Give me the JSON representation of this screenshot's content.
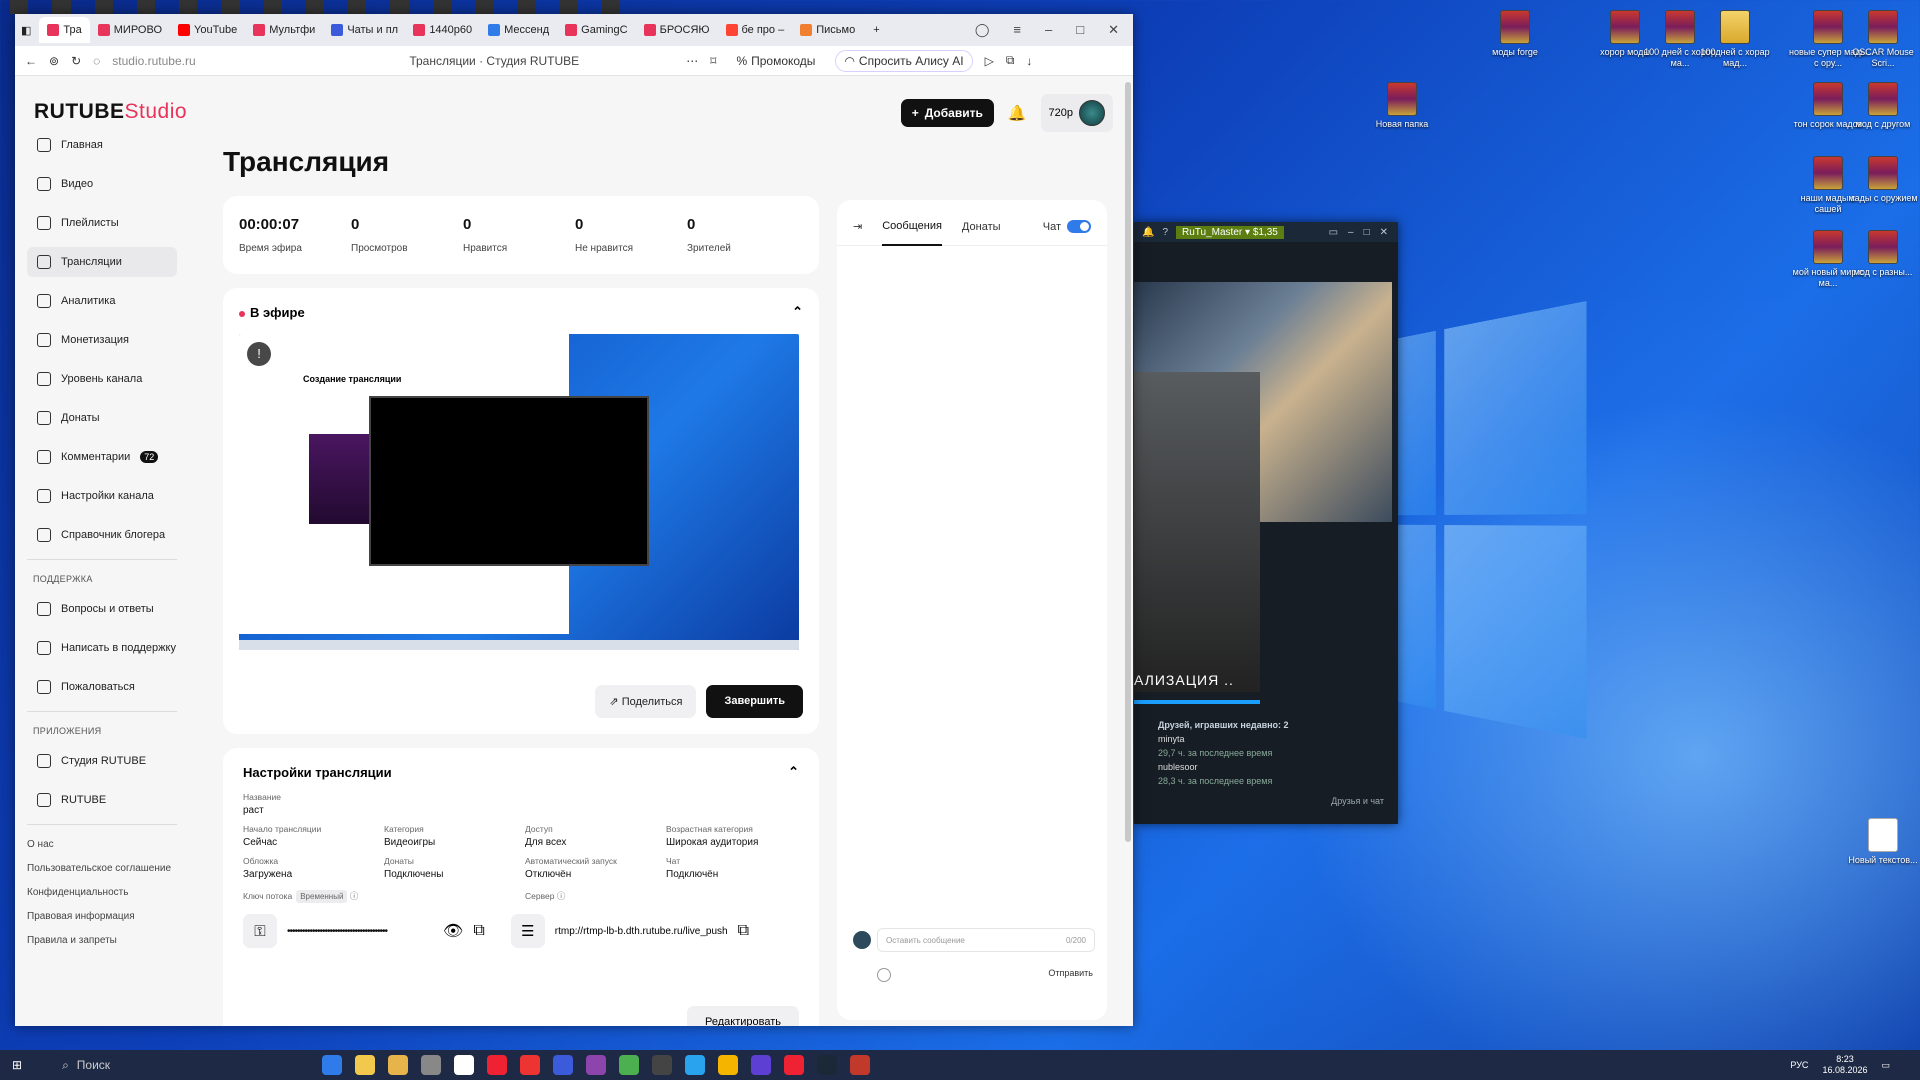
{
  "desktop": {
    "icons": [
      {
        "label": "моды forge",
        "kind": "rar"
      },
      {
        "label": "хорор моды",
        "kind": "rar"
      },
      {
        "label": "100 дней с хорор ма...",
        "kind": "rar"
      },
      {
        "label": "100дней с хорар мад...",
        "kind": "folder"
      },
      {
        "label": "новые супер мады с ору...",
        "kind": "rar"
      },
      {
        "label": "OSCAR Mouse Scri...",
        "kind": "rar"
      },
      {
        "label": "Новая папка",
        "kind": "rar"
      },
      {
        "label": "тон сорок мадов",
        "kind": "rar"
      },
      {
        "label": "мод с другом",
        "kind": "rar"
      },
      {
        "label": "наши мады с сашей",
        "kind": "rar"
      },
      {
        "label": "мады с оружием",
        "kind": "rar"
      },
      {
        "label": "мой новый мир с ма...",
        "kind": "rar"
      },
      {
        "label": "мод с разны...",
        "kind": "rar"
      },
      {
        "label": "Новый текстов...",
        "kind": "doc"
      }
    ]
  },
  "browser": {
    "tabs": [
      {
        "label": "Тра",
        "color": "#e8345a",
        "active": true
      },
      {
        "label": "МИРОВО",
        "color": "#e8345a"
      },
      {
        "label": "YouTube",
        "color": "#ff0000"
      },
      {
        "label": "Мультфи",
        "color": "#e8345a"
      },
      {
        "label": "Чаты и пл",
        "color": "#3b5bdb"
      },
      {
        "label": "1440р60",
        "color": "#e8345a"
      },
      {
        "label": "Мессенд",
        "color": "#2f7bea"
      },
      {
        "label": "GamingC",
        "color": "#e8345a"
      },
      {
        "label": "БРОСЯЮ",
        "color": "#e8345a"
      },
      {
        "label": "бе про –",
        "color": "#ff4433"
      },
      {
        "label": "Письмо",
        "color": "#f08030"
      }
    ],
    "url": "studio.rutube.ru",
    "page_title": "Трансляции · Студия RUTUBE",
    "promo": "Промокоды",
    "alice": "Спросить Алису AI"
  },
  "studio": {
    "logo_main": "RUTUBE",
    "logo_sub": "Studio",
    "add_button": "Добавить",
    "quality": "720р",
    "sidebar": [
      {
        "label": "Главная"
      },
      {
        "label": "Видео"
      },
      {
        "label": "Плейлисты"
      },
      {
        "label": "Трансляции",
        "active": true
      },
      {
        "label": "Аналитика"
      },
      {
        "label": "Монетизация"
      },
      {
        "label": "Уровень канала"
      },
      {
        "label": "Донаты"
      },
      {
        "label": "Комментарии",
        "badge": "72"
      },
      {
        "label": "Настройки канала"
      },
      {
        "label": "Справочник блогера"
      }
    ],
    "support_title": "ПОДДЕРЖКА",
    "support": [
      "Вопросы и ответы",
      "Написать в поддержку",
      "Пожаловаться"
    ],
    "apps_title": "ПРИЛОЖЕНИЯ",
    "apps": [
      "Студия RUTUBE",
      "RUTUBE"
    ],
    "footer_links": [
      "О нас",
      "Пользовательское соглашение",
      "Конфиденциальность",
      "Правовая информация",
      "Правила и запреты"
    ],
    "page_heading": "Трансляция",
    "stats": [
      {
        "value": "00:00:07",
        "label": "Время эфира"
      },
      {
        "value": "0",
        "label": "Просмотров"
      },
      {
        "value": "0",
        "label": "Нравится"
      },
      {
        "value": "0",
        "label": "Не нравится"
      },
      {
        "value": "0",
        "label": "Зрителей"
      }
    ],
    "live_title": "В эфире",
    "preview_title": "Создание трансляции",
    "share": "Поделиться",
    "finish": "Завершить",
    "settings_title": "Настройки трансляции",
    "name_label": "Название",
    "name_value": "раст",
    "fields": [
      {
        "label": "Начало трансляции",
        "value": "Сейчас"
      },
      {
        "label": "Категория",
        "value": "Видеоигры"
      },
      {
        "label": "Доступ",
        "value": "Для всех"
      },
      {
        "label": "Возрастная категория",
        "value": "Широкая аудитория"
      },
      {
        "label": "Обложка",
        "value": "Загружена"
      },
      {
        "label": "Донаты",
        "value": "Подключены"
      },
      {
        "label": "Автоматический запуск",
        "value": "Отключён"
      },
      {
        "label": "Чат",
        "value": "Подключён"
      }
    ],
    "key_label": "Ключ потока",
    "key_tag": "Временный",
    "key_masked": "••••••••••••••••••••••••••••••••••••••••",
    "server_label": "Сервер",
    "server_value": "rtmp://rtmp-lb-b.dth.rutube.ru/live_push",
    "edit": "Редактировать",
    "chat": {
      "tab_messages": "Сообщения",
      "tab_donates": "Донаты",
      "chat_label": "Чат",
      "placeholder": "Оставить сообщение",
      "counter": "0/200",
      "send": "Отправить"
    }
  },
  "steam": {
    "user": "RuTu_Master",
    "balance": "$1,35",
    "title": "АЛИЗАЦИЯ ..",
    "friends_header": "Друзей, игравших недавно: 2",
    "friends": [
      {
        "name": "minyta",
        "detail": "29,7 ч. за последнее время"
      },
      {
        "name": "nublesoor",
        "detail": "28,3 ч. за последнее время"
      }
    ],
    "footer": "Друзья и чат"
  },
  "taskbar": {
    "search": "Поиск",
    "lang": "РУС",
    "time": "8:23",
    "date": "16.08.2026"
  }
}
